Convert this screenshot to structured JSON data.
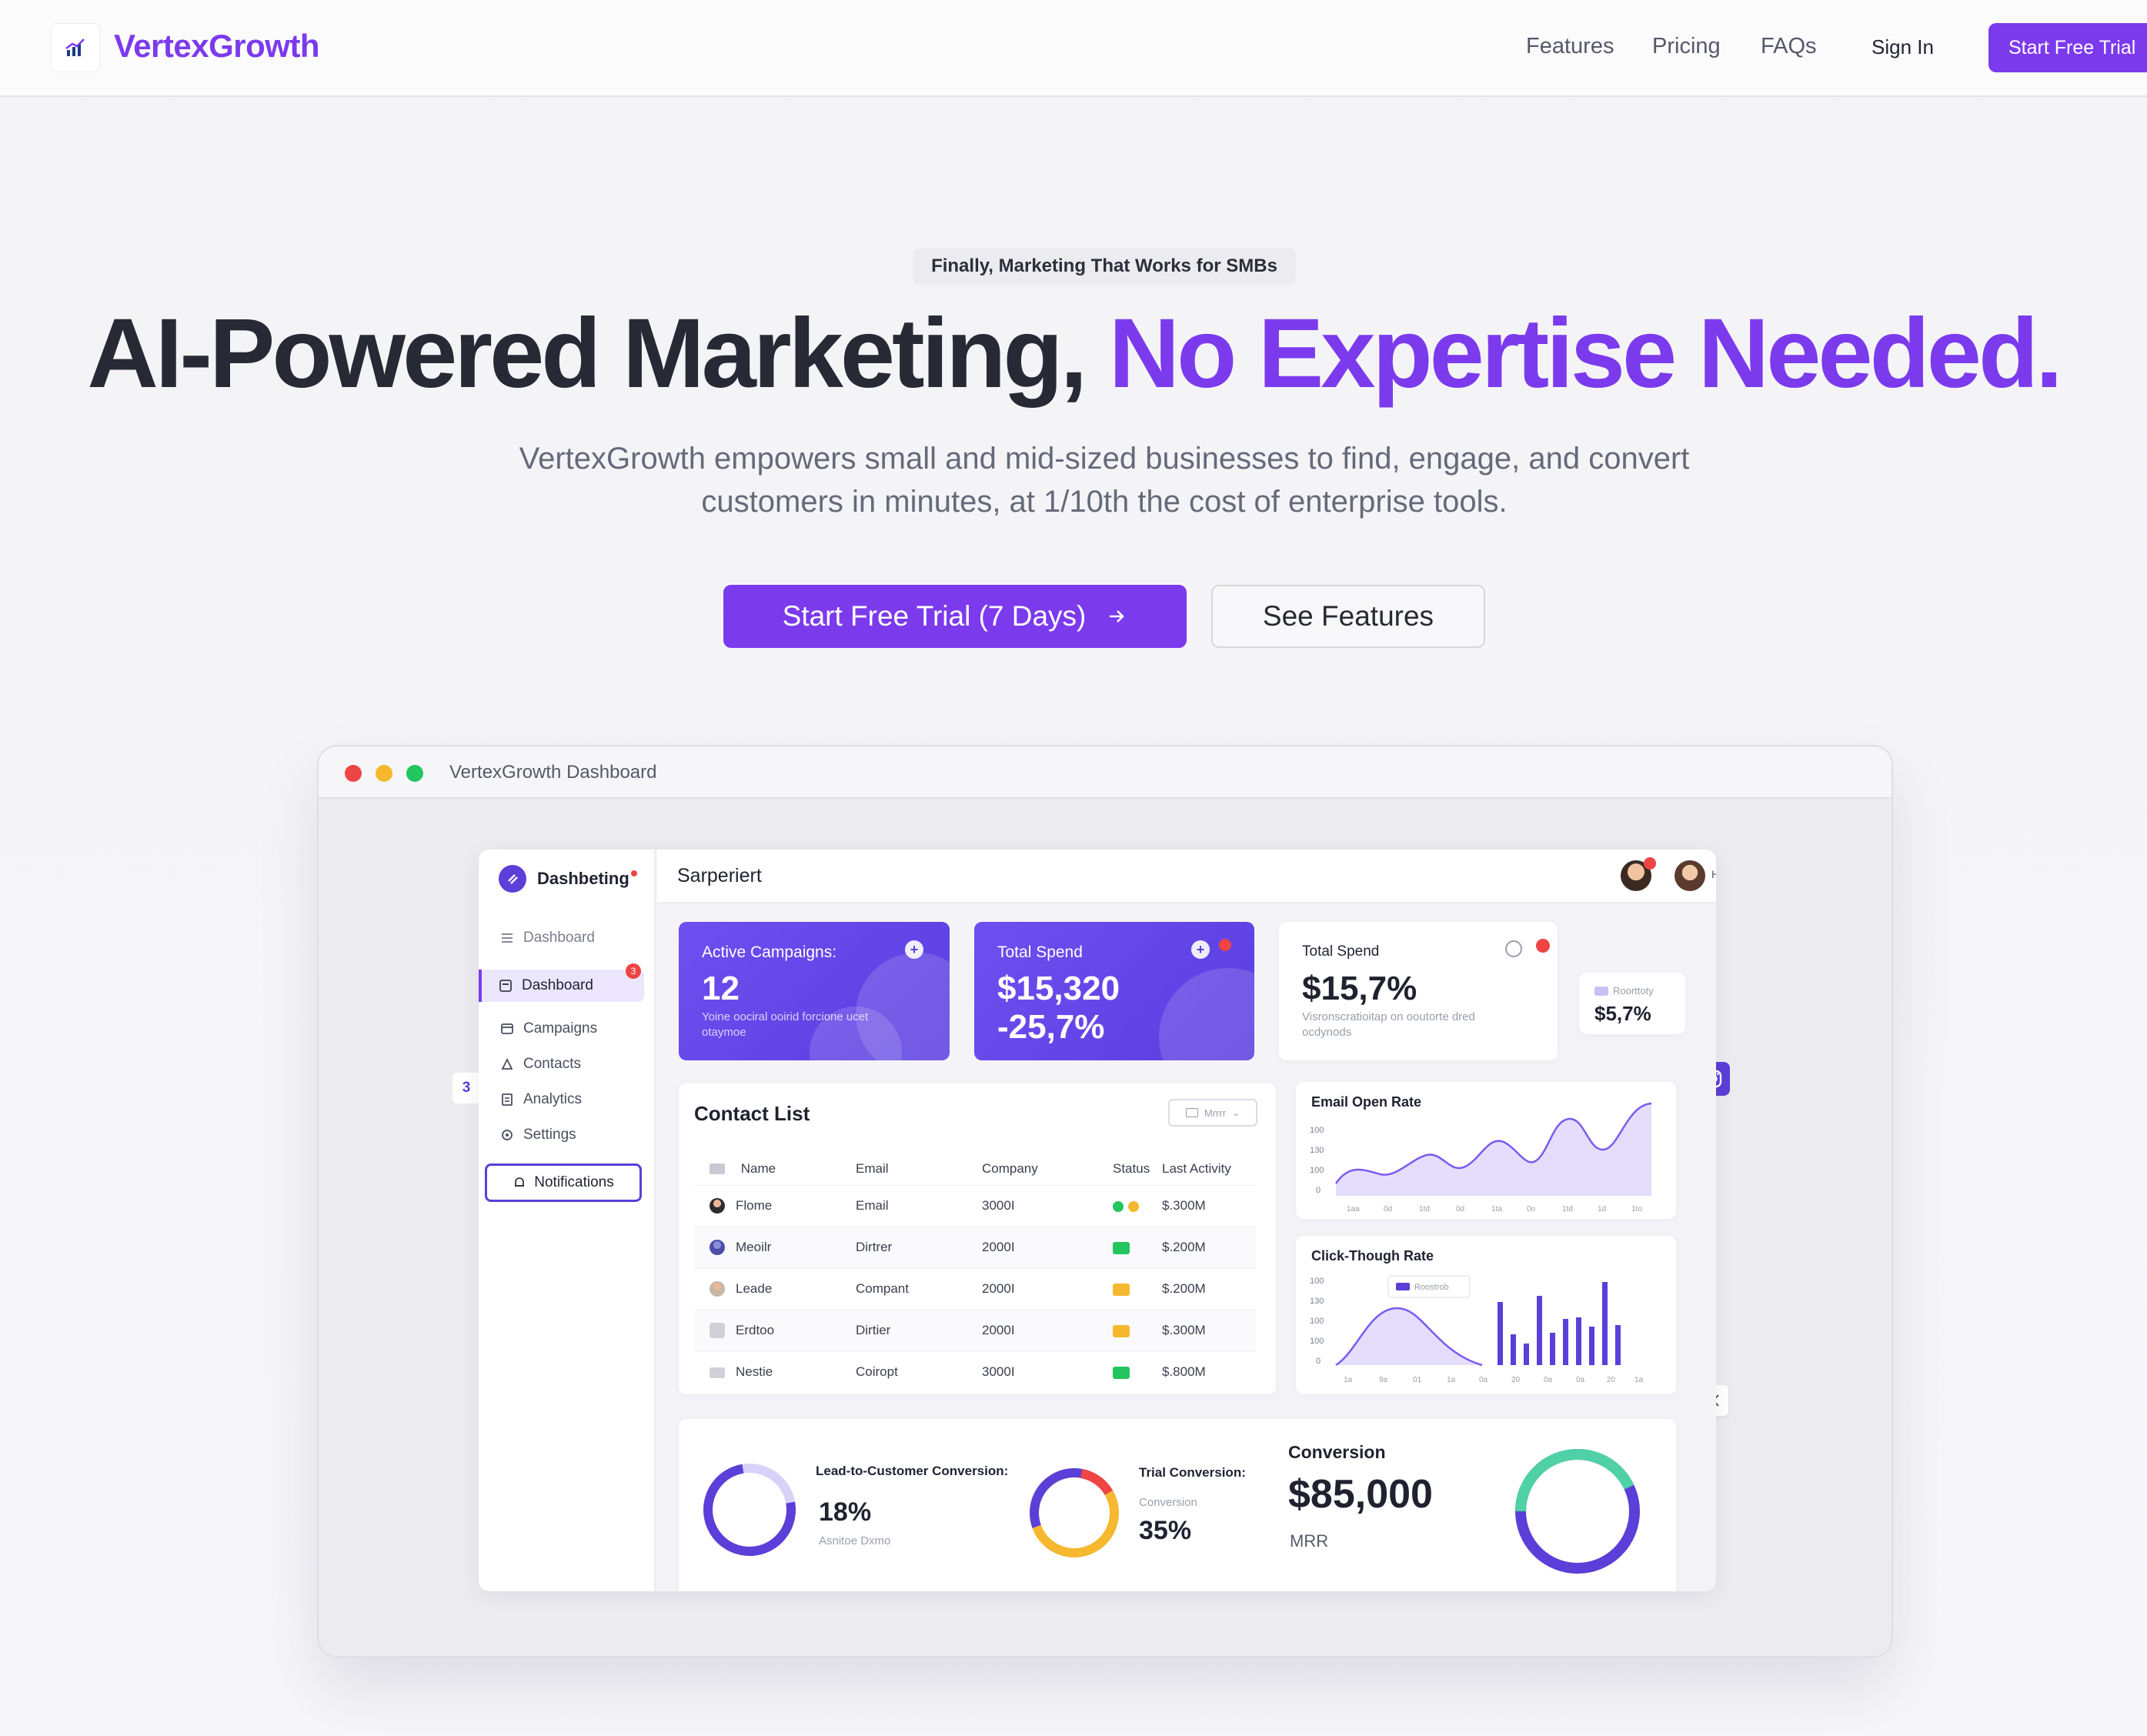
{
  "nav": {
    "brand": "VertexGrowth",
    "links": [
      "Features",
      "Pricing",
      "FAQs"
    ],
    "sign_in": "Sign In",
    "cta": "Start Free Trial"
  },
  "hero": {
    "badge": "Finally, Marketing That Works for SMBs",
    "headline_dark": "AI-Powered Marketing,",
    "headline_accent": "No Expertise Needed.",
    "subline": "VertexGrowth empowers small and mid-sized businesses to find, engage, and convert customers in minutes, at 1/10th the cost of enterprise tools.",
    "cta_primary": "Start Free Trial (7 Days)",
    "cta_secondary": "See Features"
  },
  "frame": {
    "title": "VertexGrowth Dashboard"
  },
  "app": {
    "brand": "Dashbeting",
    "topbar_title": "Sarperiert",
    "topbar_user": "Hi",
    "sidebar": {
      "header": "Dashboard",
      "items": [
        "Dashboard",
        "Campaigns",
        "Contacts",
        "Analytics",
        "Settings"
      ],
      "dashboard_badge": "3",
      "side_tab": "3",
      "notifications": "Notifications"
    },
    "kpis": [
      {
        "label": "Active Campaigns:",
        "value": "12",
        "sub": "Yoine oociral ooirid forcione ucet otaymoe"
      },
      {
        "label": "Total Spend",
        "value": "$15,320",
        "value2": "-25,7%"
      },
      {
        "label": "Total Spend",
        "value": "$15,7%",
        "sub": "Visronscratioitap on ooutorte dred ocdynods"
      },
      {
        "label": "Roorttoty",
        "value": "$5,7%"
      }
    ],
    "contacts": {
      "title": "Contact List",
      "filter": "Mrrrr",
      "columns": [
        "Name",
        "Email",
        "Company",
        "Status",
        "Last Activity"
      ],
      "rows": [
        {
          "name": "Flome",
          "email": "Email",
          "company": "3000I",
          "activity": "$.300M"
        },
        {
          "name": "Meoilr",
          "email": "Dirtrer",
          "company": "2000I",
          "activity": "$.200M"
        },
        {
          "name": "Leade",
          "email": "Compant",
          "company": "2000I",
          "activity": "$.200M"
        },
        {
          "name": "Erdtoo",
          "email": "Dirtier",
          "company": "2000I",
          "activity": "$.300M"
        },
        {
          "name": "Nestie",
          "email": "Coiropt",
          "company": "3000I",
          "activity": "$.800M"
        }
      ]
    },
    "email_chart": {
      "title": "Email Open Rate",
      "y_ticks": [
        "100",
        "130",
        "100",
        "0"
      ],
      "x_ticks": [
        "1aa",
        "0d",
        "1td",
        "0d",
        "1ta",
        "0o",
        "1td",
        "1d",
        "1to"
      ]
    },
    "ctr_chart": {
      "title": "Click-Though Rate",
      "tooltip": "Roostrob",
      "y_ticks": [
        "100",
        "130",
        "100",
        "100",
        "0"
      ],
      "x_ticks": [
        "1a",
        "9a",
        "01",
        "1a",
        "0a",
        "20",
        "0a",
        "0a",
        "20",
        "1a"
      ]
    },
    "conversion": {
      "lead_label": "Lead-to-Customer Conversion:",
      "lead_value": "18%",
      "lead_sub": "Asnitoe Dxmo",
      "trial_label": "Trial Conversion:",
      "trial_sub": "Conversion",
      "trial_value": "35%",
      "mrr_label": "Conversion",
      "mrr_value": "$85,000",
      "mrr_sub": "MRR"
    }
  },
  "colors": {
    "accent": "#7c3aed",
    "app_purple": "#5b3fd8",
    "green": "#22c55e",
    "yellow": "#f5b82e",
    "red": "#ef4444",
    "teal": "#4fd1a5"
  }
}
